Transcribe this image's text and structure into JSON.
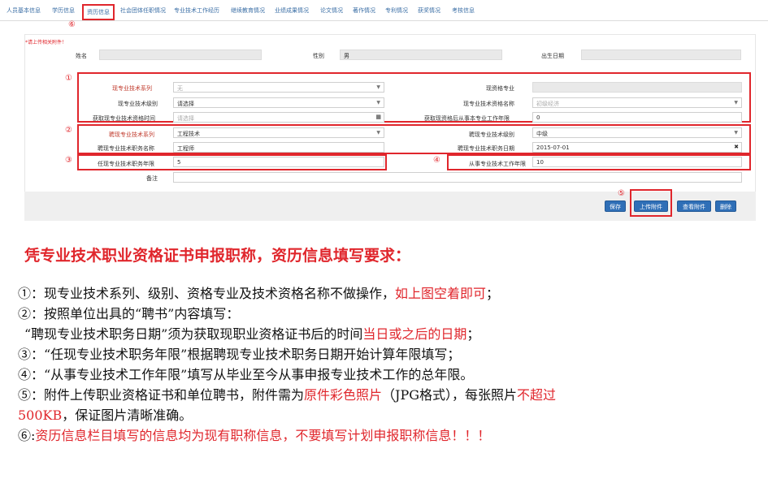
{
  "tabs": [
    "人员基本信息",
    "学历信息",
    "资历信息",
    "社会团体任职情况",
    "专业技术工作经历",
    "继续教育情况",
    "业绩成果情况",
    "论文情况",
    "著作情况",
    "专利情况",
    "获奖情况",
    "考核信息"
  ],
  "step_markers": [
    "⑥",
    "①",
    "②",
    "③",
    "④",
    "⑤"
  ],
  "form": {
    "hint": "*请上传相关附件！",
    "name_label": "姓名",
    "gender_label": "性别",
    "gender_value": "男",
    "birth_label": "出生日期",
    "series_label": "现专业技术系列",
    "series_value": "无",
    "current_major_label": "现资格专业",
    "level_label": "现专业技术级别",
    "level_value": "请选择",
    "qual_name_label": "现专业技术资格名称",
    "qual_name_value": "初级经济",
    "qual_time_label": "获取现专业技术资格时间",
    "qual_time_value": "请选择",
    "years_after_label": "获取现资格后从事本专业工作年限",
    "years_after_value": "0",
    "hire_series_label": "聘现专业技术系列",
    "hire_series_value": "工程技术",
    "hire_level_label": "聘现专业技术级别",
    "hire_level_value": "中级",
    "hire_title_label": "聘现专业技术职务名称",
    "hire_title_value": "工程师",
    "hire_date_label": "聘现专业技术职务日期",
    "hire_date_value": "2015-07-01",
    "term_label": "任现专业技术职务年限",
    "term_value": "5",
    "work_years_label": "从事专业技术工作年限",
    "work_years_value": "10",
    "remark_label": "备注"
  },
  "buttons": {
    "save": "保存",
    "upload": "上传附件",
    "view": "查看附件",
    "delete": "删除"
  },
  "instructions": {
    "heading": "凭专业技术职业资格证书申报职称，资历信息填写要求：",
    "l1a": "①：现专业技术系列、级别、资格专业及技术资格名称不做操作，",
    "l1b": "如上图空着即可",
    "l1c": "；",
    "l2": "②：按照单位出具的“聘书”内容填写：",
    "l3a": "“聘现专业技术职务日期”须为获取现职业资格证书后的时间",
    "l3b": "当日或之后的日期",
    "l3c": "；",
    "l4": "③：“任现专业技术职务年限”根据聘现专业技术职务日期开始计算年限填写；",
    "l5": "④：“从事专业技术工作年限”填写从毕业至今从事申报专业技术工作的总年限。",
    "l6a": "⑤：附件上传职业资格证书和单位聘书，附件需为",
    "l6b": "原件彩色照片",
    "l6c": "（JPG格式），每张照片",
    "l6d": "不超过",
    "l7a": "500KB",
    "l7b": "，保证图片清晰准确。",
    "l8a": "⑥:",
    "l8b": "资历信息栏目填写的信息均为现有职称信息，不要填写计划申报职称信息！！！"
  }
}
